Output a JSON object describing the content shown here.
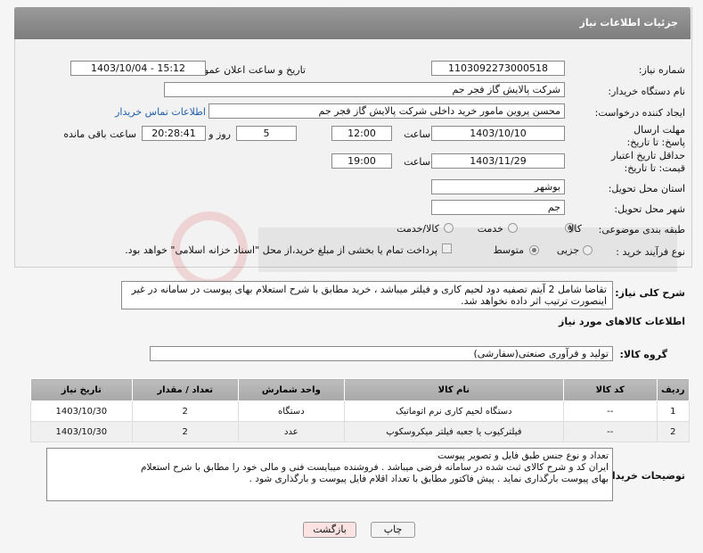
{
  "header": {
    "title": "جزئیات اطلاعات نیاز"
  },
  "form": {
    "need_number": {
      "label": "شماره نیاز:",
      "value": "1103092273000518"
    },
    "announce_datetime": {
      "label": "تاریخ و ساعت اعلان عمومی:",
      "value": "1403/10/04 - 15:12"
    },
    "buyer_org": {
      "label": "نام دستگاه خریدار:",
      "value": "شرکت پالایش گاز فجر جم"
    },
    "requester": {
      "label": "ایجاد کننده درخواست:",
      "value": "محسن پروین مامور خرید داخلی شرکت پالایش گاز فجر جم",
      "contact_link": "اطلاعات تماس خریدار"
    },
    "reply_deadline": {
      "label": "مهلت ارسال پاسخ: تا تاریخ:",
      "date": "1403/10/10",
      "time_label": "ساعت",
      "time": "12:00",
      "days": "5",
      "days_label": "روز و",
      "remaining": "20:28:41",
      "remaining_label": "ساعت باقی مانده"
    },
    "price_validity": {
      "label": "حداقل تاریخ اعتبار قیمت: تا تاریخ:",
      "date": "1403/11/29",
      "time_label": "ساعت",
      "time": "19:00"
    },
    "province": {
      "label": "استان محل تحویل:",
      "value": "بوشهر"
    },
    "city": {
      "label": "شهر محل تحویل:",
      "value": "جم"
    },
    "category": {
      "label": "طبقه بندی موضوعی:",
      "options": [
        "کالا",
        "خدمت",
        "کالا/خدمت"
      ],
      "selected": "کالا"
    },
    "purchase_type": {
      "label": "نوع فرآیند خرید :",
      "options": [
        "جزیی",
        "متوسط"
      ],
      "selected": "متوسط",
      "note": "پرداخت تمام یا بخشی از مبلغ خرید،از محل \"اسناد خزانه اسلامی\" خواهد بود."
    }
  },
  "summary": {
    "label": "شرح کلی نیاز:",
    "text": "تقاضا شامل 2 آیتم تصفیه دود لحیم کاری و فیلتر میباشد ، خرید مطابق با شرح استعلام بهای پیوست در سامانه در غیر اینصورت ترتیب اثر داده نخواهد شد."
  },
  "goods": {
    "section_title": "اطلاعات کالاهای مورد نیاز",
    "group_label": "گروه کالا:",
    "group_value": "تولید و فرآوری صنعتی(سفارشی)",
    "columns": [
      "ردیف",
      "کد کالا",
      "نام کالا",
      "واحد شمارش",
      "تعداد / مقدار",
      "تاریخ نیاز"
    ],
    "rows": [
      [
        "1",
        "--",
        "دستگاه لحیم کاری نرم اتوماتیک",
        "دستگاه",
        "2",
        "1403/10/30"
      ],
      [
        "2",
        "--",
        "فیلترکیوب یا جعبه فیلتر میکروسکوپ",
        "عدد",
        "2",
        "1403/10/30"
      ]
    ]
  },
  "buyer_notes": {
    "label": "توضیحات خریدار:",
    "lines": [
      "تعداد و نوع جنس طبق فایل و تصویر پیوست",
      "ایران کد و شرح کالای ثبت شده در سامانه فرضی میباشد . فروشنده میبایست فنی و مالی خود را مطابق با شرح استعلام",
      "بهای پیوست بارگذاری نماید . پیش فاکتور مطابق با تعداد اقلام فایل پیوست و بارگذاری شود ."
    ]
  },
  "buttons": {
    "print": "چاپ",
    "back": "بازگشت"
  },
  "colors": {
    "header": "#8a8a8a",
    "link": "#2060b0",
    "back_button": "#fbe3e3"
  }
}
